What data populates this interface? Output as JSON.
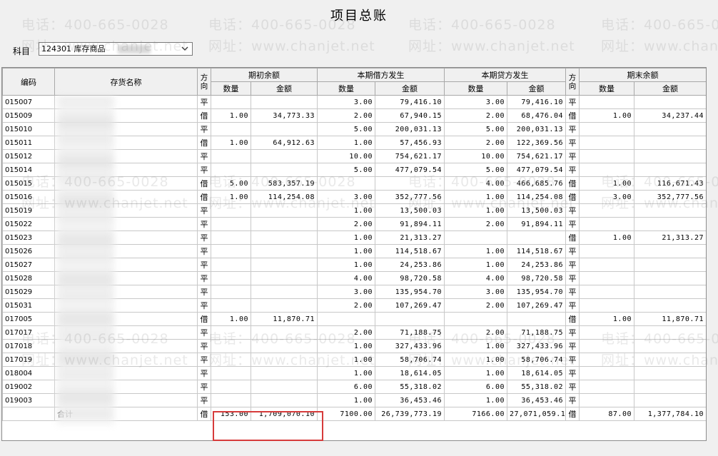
{
  "window": {
    "title": "项目总账"
  },
  "subject": {
    "label": "科目",
    "value": "124301 库存商品"
  },
  "watermark": {
    "phone": "电话：400-665-0028",
    "site": "网址：www.chanjet.net"
  },
  "headers": {
    "code": "编码",
    "name": "存货名称",
    "dir1": "方向",
    "opening": "期初余额",
    "debit": "本期借方发生",
    "credit": "本期贷方发生",
    "dir2": "方向",
    "closing": "期末余额",
    "qty": "数量",
    "amt": "金额"
  },
  "rows": [
    {
      "code": "015007",
      "name": "",
      "dir1": "平",
      "oq": "",
      "oa": "",
      "dq": "3.00",
      "da": "79,416.10",
      "cq": "3.00",
      "ca": "79,416.10",
      "dir2": "平",
      "eq": "",
      "ea": ""
    },
    {
      "code": "015009",
      "name": "",
      "dir1": "借",
      "oq": "1.00",
      "oa": "34,773.33",
      "dq": "2.00",
      "da": "67,940.15",
      "cq": "2.00",
      "ca": "68,476.04",
      "dir2": "借",
      "eq": "1.00",
      "ea": "34,237.44"
    },
    {
      "code": "015010",
      "name": "",
      "dir1": "平",
      "oq": "",
      "oa": "",
      "dq": "5.00",
      "da": "200,031.13",
      "cq": "5.00",
      "ca": "200,031.13",
      "dir2": "平",
      "eq": "",
      "ea": ""
    },
    {
      "code": "015011",
      "name": "",
      "dir1": "借",
      "oq": "1.00",
      "oa": "64,912.63",
      "dq": "1.00",
      "da": "57,456.93",
      "cq": "2.00",
      "ca": "122,369.56",
      "dir2": "平",
      "eq": "",
      "ea": ""
    },
    {
      "code": "015012",
      "name": "",
      "dir1": "平",
      "oq": "",
      "oa": "",
      "dq": "10.00",
      "da": "754,621.17",
      "cq": "10.00",
      "ca": "754,621.17",
      "dir2": "平",
      "eq": "",
      "ea": ""
    },
    {
      "code": "015014",
      "name": "",
      "dir1": "平",
      "oq": "",
      "oa": "",
      "dq": "5.00",
      "da": "477,079.54",
      "cq": "5.00",
      "ca": "477,079.54",
      "dir2": "平",
      "eq": "",
      "ea": ""
    },
    {
      "code": "015015",
      "name": "",
      "dir1": "借",
      "oq": "5.00",
      "oa": "583,357.19",
      "dq": "",
      "da": "",
      "cq": "4.00",
      "ca": "466,685.76",
      "dir2": "借",
      "eq": "1.00",
      "ea": "116,671.43"
    },
    {
      "code": "015016",
      "name": "",
      "dir1": "借",
      "oq": "1.00",
      "oa": "114,254.08",
      "dq": "3.00",
      "da": "352,777.56",
      "cq": "1.00",
      "ca": "114,254.08",
      "dir2": "借",
      "eq": "3.00",
      "ea": "352,777.56"
    },
    {
      "code": "015019",
      "name": "",
      "dir1": "平",
      "oq": "",
      "oa": "",
      "dq": "1.00",
      "da": "13,500.03",
      "cq": "1.00",
      "ca": "13,500.03",
      "dir2": "平",
      "eq": "",
      "ea": ""
    },
    {
      "code": "015022",
      "name": "",
      "dir1": "平",
      "oq": "",
      "oa": "",
      "dq": "2.00",
      "da": "91,894.11",
      "cq": "2.00",
      "ca": "91,894.11",
      "dir2": "平",
      "eq": "",
      "ea": ""
    },
    {
      "code": "015023",
      "name": "",
      "dir1": "平",
      "oq": "",
      "oa": "",
      "dq": "1.00",
      "da": "21,313.27",
      "cq": "",
      "ca": "",
      "dir2": "借",
      "eq": "1.00",
      "ea": "21,313.27"
    },
    {
      "code": "015026",
      "name": "",
      "dir1": "平",
      "oq": "",
      "oa": "",
      "dq": "1.00",
      "da": "114,518.67",
      "cq": "1.00",
      "ca": "114,518.67",
      "dir2": "平",
      "eq": "",
      "ea": ""
    },
    {
      "code": "015027",
      "name": "",
      "dir1": "平",
      "oq": "",
      "oa": "",
      "dq": "1.00",
      "da": "24,253.86",
      "cq": "1.00",
      "ca": "24,253.86",
      "dir2": "平",
      "eq": "",
      "ea": ""
    },
    {
      "code": "015028",
      "name": "",
      "dir1": "平",
      "oq": "",
      "oa": "",
      "dq": "4.00",
      "da": "98,720.58",
      "cq": "4.00",
      "ca": "98,720.58",
      "dir2": "平",
      "eq": "",
      "ea": ""
    },
    {
      "code": "015029",
      "name": "",
      "dir1": "平",
      "oq": "",
      "oa": "",
      "dq": "3.00",
      "da": "135,954.70",
      "cq": "3.00",
      "ca": "135,954.70",
      "dir2": "平",
      "eq": "",
      "ea": ""
    },
    {
      "code": "015031",
      "name": "",
      "dir1": "平",
      "oq": "",
      "oa": "",
      "dq": "2.00",
      "da": "107,269.47",
      "cq": "2.00",
      "ca": "107,269.47",
      "dir2": "平",
      "eq": "",
      "ea": ""
    },
    {
      "code": "017005",
      "name": "",
      "dir1": "借",
      "oq": "1.00",
      "oa": "11,870.71",
      "dq": "",
      "da": "",
      "cq": "",
      "ca": "",
      "dir2": "借",
      "eq": "1.00",
      "ea": "11,870.71"
    },
    {
      "code": "017017",
      "name": "",
      "dir1": "平",
      "oq": "",
      "oa": "",
      "dq": "2.00",
      "da": "71,188.75",
      "cq": "2.00",
      "ca": "71,188.75",
      "dir2": "平",
      "eq": "",
      "ea": ""
    },
    {
      "code": "017018",
      "name": "",
      "dir1": "平",
      "oq": "",
      "oa": "",
      "dq": "1.00",
      "da": "327,433.96",
      "cq": "1.00",
      "ca": "327,433.96",
      "dir2": "平",
      "eq": "",
      "ea": ""
    },
    {
      "code": "017019",
      "name": "",
      "dir1": "平",
      "oq": "",
      "oa": "",
      "dq": "1.00",
      "da": "58,706.74",
      "cq": "1.00",
      "ca": "58,706.74",
      "dir2": "平",
      "eq": "",
      "ea": ""
    },
    {
      "code": "018004",
      "name": "",
      "dir1": "平",
      "oq": "",
      "oa": "",
      "dq": "1.00",
      "da": "18,614.05",
      "cq": "1.00",
      "ca": "18,614.05",
      "dir2": "平",
      "eq": "",
      "ea": ""
    },
    {
      "code": "019002",
      "name": "",
      "dir1": "平",
      "oq": "",
      "oa": "",
      "dq": "6.00",
      "da": "55,318.02",
      "cq": "6.00",
      "ca": "55,318.02",
      "dir2": "平",
      "eq": "",
      "ea": ""
    },
    {
      "code": "019003",
      "name": "",
      "dir1": "平",
      "oq": "",
      "oa": "",
      "dq": "1.00",
      "da": "36,453.46",
      "cq": "1.00",
      "ca": "36,453.46",
      "dir2": "平",
      "eq": "",
      "ea": ""
    }
  ],
  "total": {
    "code": "",
    "name": "合计",
    "dir1": "借",
    "oq": "153.00",
    "oa": "1,709,070.10",
    "dq": "7100.00",
    "da": "26,739,773.19",
    "cq": "7166.00",
    "ca": "27,071,059.19",
    "dir2": "借",
    "eq": "87.00",
    "ea": "1,377,784.10"
  }
}
